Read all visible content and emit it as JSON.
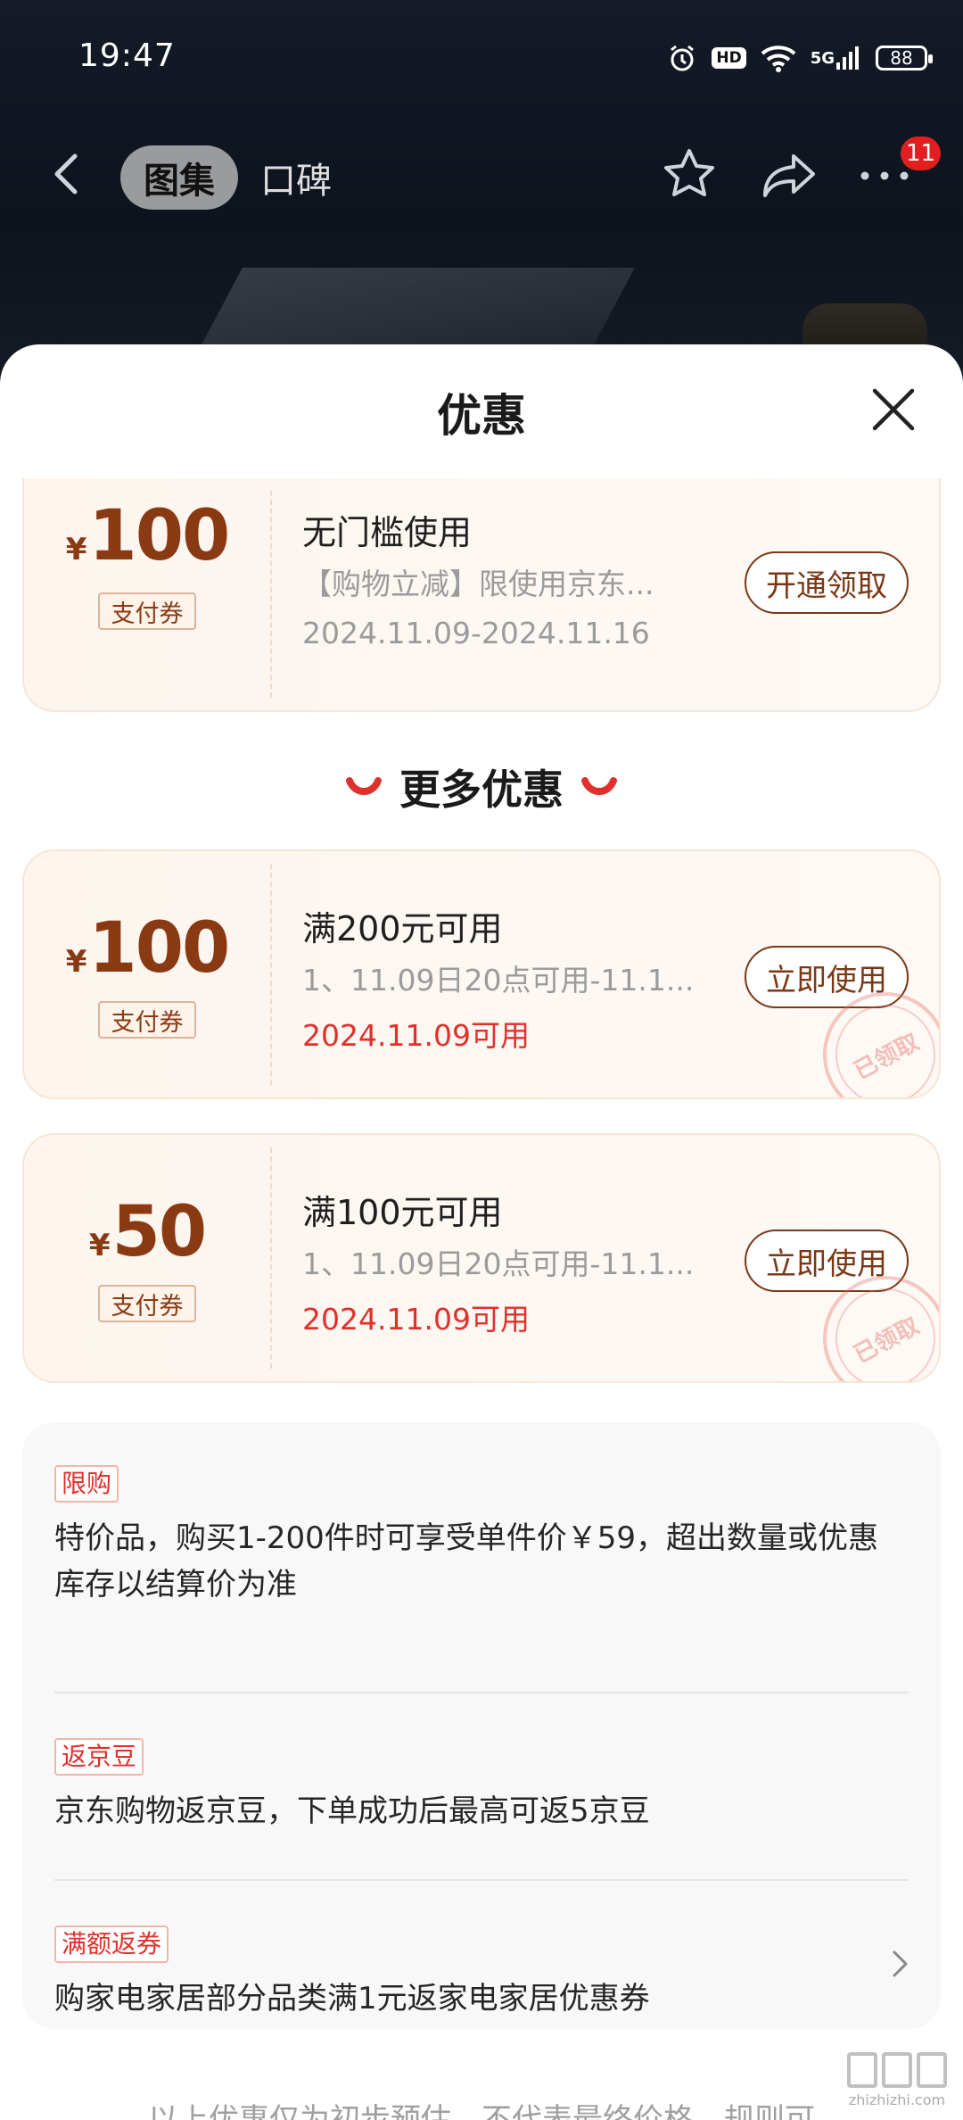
{
  "status_bar": {
    "time": "19:47",
    "hd": "HD",
    "network": "5G",
    "battery": "88"
  },
  "nav": {
    "tab_album": "图集",
    "tab_reviews": "口碑",
    "badge_count": "11"
  },
  "sheet": {
    "title": "优惠",
    "more_heading": "更多优惠",
    "coupons": [
      {
        "currency": "¥",
        "amount": "100",
        "type_tag": "支付券",
        "title": "无门槛使用",
        "desc": "【购物立减】限使用京东...",
        "date": "2024.11.09-2024.11.16",
        "button": "开通领取"
      },
      {
        "currency": "¥",
        "amount": "100",
        "type_tag": "支付券",
        "title": "满200元可用",
        "desc": "1、11.09日20点可用-11.1...",
        "date": "2024.11.09可用",
        "button": "立即使用",
        "stamp": "已领取"
      },
      {
        "currency": "¥",
        "amount": "50",
        "type_tag": "支付券",
        "title": "满100元可用",
        "desc": "1、11.09日20点可用-11.1...",
        "date": "2024.11.09可用",
        "button": "立即使用",
        "stamp": "已领取"
      }
    ],
    "promotions": [
      {
        "tag": "限购",
        "text": "特价品，购买1-200件时可享受单件价￥59，超出数量或优惠库存以结算价为准"
      },
      {
        "tag": "返京豆",
        "text": "京东购物返京豆，下单成功后最高可返5京豆"
      },
      {
        "tag": "满额返券",
        "text": "购家电家居部分品类满1元返家电家居优惠券"
      }
    ],
    "footer_note": "以上优惠仅为初步预估，不代表最终价格，规则可"
  },
  "watermark": {
    "text": "zhizhizhi.com"
  },
  "colors": {
    "accent_brown": "#7a3816",
    "accent_red": "#e0302c",
    "coupon_bg": "#fdf5ee"
  }
}
